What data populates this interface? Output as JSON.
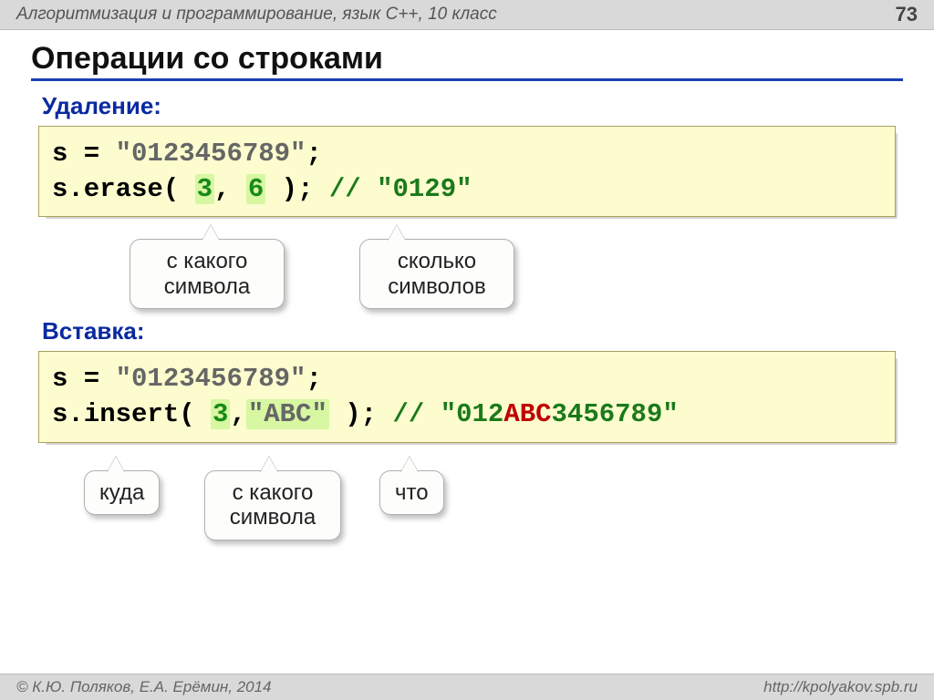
{
  "header": {
    "course": "Алгоритмизация и программирование, язык C++, 10 класс",
    "page": "73"
  },
  "title": "Операции со строками",
  "sections": {
    "delete_label": "Удаление:",
    "insert_label": "Вставка:"
  },
  "code1": {
    "assign_lhs": "s = ",
    "assign_str": "\"0123456789\"",
    "semi": ";",
    "call_lhs": "s.erase( ",
    "arg1": "3",
    "sep": ", ",
    "arg2": "6",
    "call_rhs": " ); ",
    "comment": "// \"0129\""
  },
  "call1": {
    "from": "с какого символа",
    "count": "сколько символов"
  },
  "code2": {
    "assign_lhs": "s = ",
    "assign_str": "\"0123456789\"",
    "semi": ";",
    "call_lhs": "s.insert( ",
    "arg1": "3",
    "sep": ",",
    "arg2": "\"ABC\"",
    "call_rhs": " ); ",
    "cmt_pre": "// \"012",
    "cmt_red": "ABC",
    "cmt_post": "3456789\""
  },
  "call2": {
    "where": "куда",
    "from": "с какого символа",
    "what": "что"
  },
  "footer": {
    "copyright": "© К.Ю. Поляков, Е.А. Ерёмин, 2014",
    "url": "http://kpolyakov.spb.ru"
  }
}
